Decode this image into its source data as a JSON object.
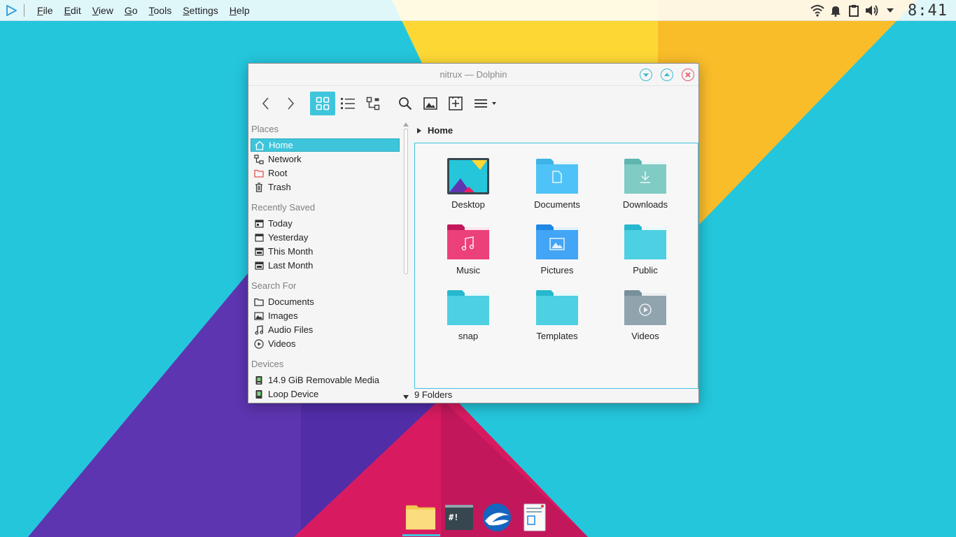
{
  "top_panel": {
    "menu": [
      {
        "u": "F",
        "rest": "ile"
      },
      {
        "u": "E",
        "rest": "dit"
      },
      {
        "u": "V",
        "rest": "iew"
      },
      {
        "u": "G",
        "rest": "o"
      },
      {
        "u": "T",
        "rest": "ools"
      },
      {
        "u": "S",
        "rest": "ettings"
      },
      {
        "u": "H",
        "rest": "elp"
      }
    ],
    "clock": "8:41"
  },
  "window": {
    "title": "nitrux — Dolphin",
    "breadcrumb": "Home",
    "status": "9 Folders"
  },
  "places": {
    "headers": {
      "places": "Places",
      "recent": "Recently Saved",
      "search": "Search For",
      "devices": "Devices"
    },
    "items": [
      {
        "label": "Home",
        "icon": "home-icon"
      },
      {
        "label": "Network",
        "icon": "network-icon"
      },
      {
        "label": "Root",
        "icon": "folder-red-icon"
      },
      {
        "label": "Trash",
        "icon": "trash-icon"
      },
      {
        "label": "Today",
        "icon": "calendar-icon"
      },
      {
        "label": "Yesterday",
        "icon": "calendar-icon"
      },
      {
        "label": "This Month",
        "icon": "calendar-icon"
      },
      {
        "label": "Last Month",
        "icon": "calendar-icon"
      },
      {
        "label": "Documents",
        "icon": "folder-outline-icon"
      },
      {
        "label": "Images",
        "icon": "image-icon"
      },
      {
        "label": "Audio Files",
        "icon": "music-note-icon"
      },
      {
        "label": "Videos",
        "icon": "play-circle-icon"
      },
      {
        "label": "14.9 GiB Removable Media",
        "icon": "usb-drive-icon"
      },
      {
        "label": "Loop Device",
        "icon": "drive-icon"
      }
    ]
  },
  "files": [
    {
      "name": "Desktop",
      "icon": "desktop-folder-icon"
    },
    {
      "name": "Documents",
      "icon": "documents-folder-icon"
    },
    {
      "name": "Downloads",
      "icon": "downloads-folder-icon"
    },
    {
      "name": "Music",
      "icon": "music-folder-icon"
    },
    {
      "name": "Pictures",
      "icon": "pictures-folder-icon"
    },
    {
      "name": "Public",
      "icon": "public-folder-icon"
    },
    {
      "name": "snap",
      "icon": "snap-folder-icon"
    },
    {
      "name": "Templates",
      "icon": "templates-folder-icon"
    },
    {
      "name": "Videos",
      "icon": "videos-folder-icon"
    }
  ],
  "dock": {
    "terminal_glyph": "#!"
  },
  "colors": {
    "accent": "#3ec5dc",
    "close": "#e9566a",
    "wallpaper_cyan": "#24c6dc",
    "wallpaper_yellow": "#fdd835",
    "wallpaper_purple": "#5e35b1",
    "wallpaper_pink": "#d81b60"
  }
}
